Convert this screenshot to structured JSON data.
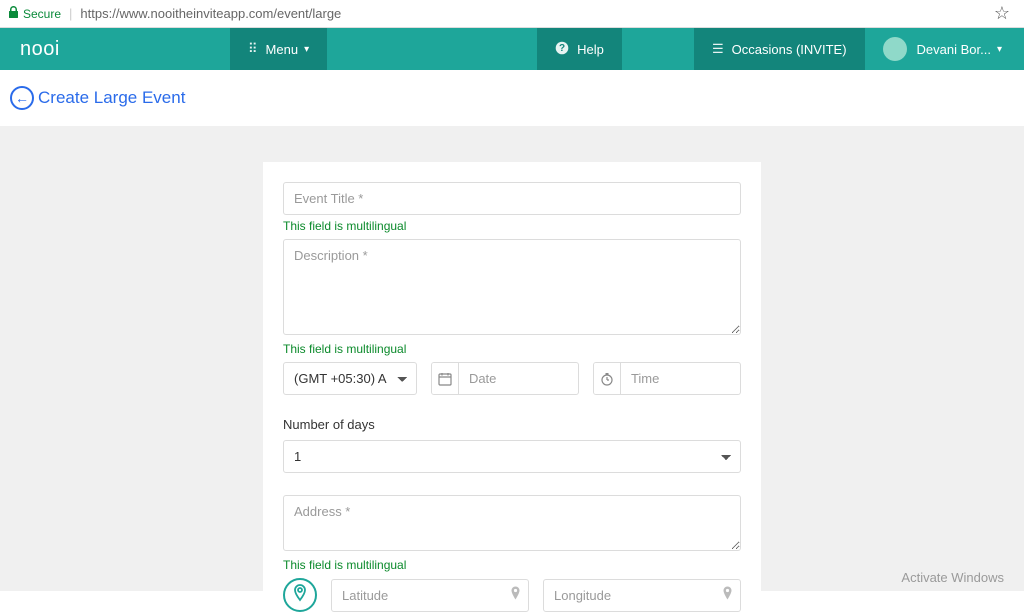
{
  "url": {
    "secure": "Secure",
    "full": "https://www.nooitheinviteapp.com/event/large"
  },
  "nav": {
    "brand": "nooi",
    "menu": "Menu",
    "help": "Help",
    "occasions": "Occasions (INVITE)",
    "user": "Devani Bor..."
  },
  "page": {
    "title": "Create Large Event"
  },
  "form": {
    "event_title_ph": "Event Title *",
    "multilingual_note": "This field is multilingual",
    "description_ph": "Description *",
    "timezone_selected": "(GMT +05:30) A",
    "date_ph": "Date",
    "time_ph": "Time",
    "days_label": "Number of days",
    "days_selected": "1",
    "address_ph": "Address *",
    "latitude_ph": "Latitude",
    "longitude_ph": "Longitude"
  },
  "watermark": "Activate Windows"
}
